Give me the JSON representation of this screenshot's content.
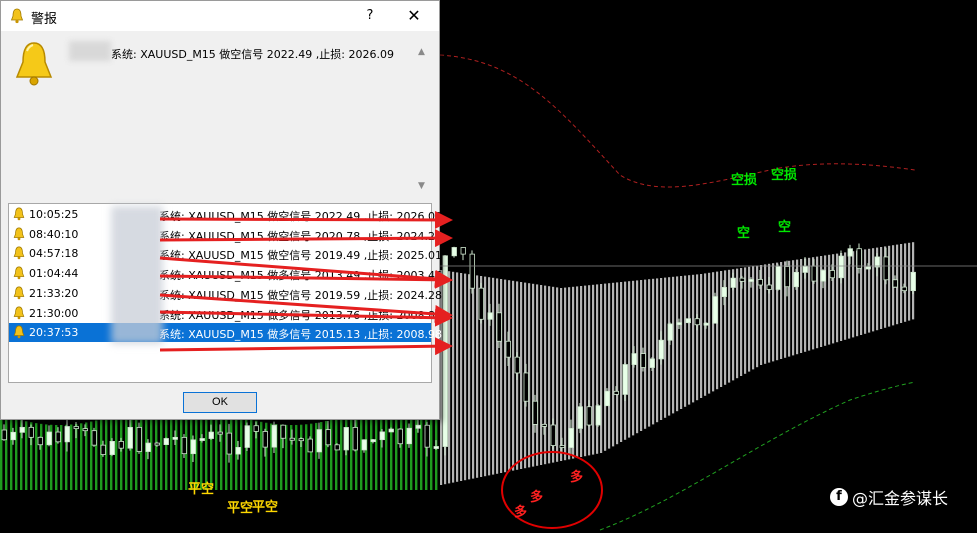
{
  "dialog": {
    "title": "警报",
    "help": "?",
    "close": "✕",
    "message": "系统:  XAUUSD_M15 做空信号 2022.49 ,止损: 2026.09",
    "ok_label": "OK",
    "alerts": [
      {
        "time": "10:05:25",
        "text": "系统:  XAUUSD_M15 做空信号 2022.49 ,止损: 2026.09"
      },
      {
        "time": "08:40:10",
        "text": "系统:  XAUUSD_M15 做空信号 2020.78 ,止损: 2024.26"
      },
      {
        "time": "04:57:18",
        "text": "系统:  XAUUSD_M15 做空信号 2019.49 ,止损: 2025.01"
      },
      {
        "time": "01:04:44",
        "text": "系统:  XAUUSD_M15 做多信号 2013.49 ,止损: 2003.46"
      },
      {
        "time": "21:33:20",
        "text": "系统:  XAUUSD_M15 做空信号 2019.59 ,止损: 2024.28"
      },
      {
        "time": "21:30:00",
        "text": "系统:  XAUUSD_M15 做多信号 2013.76 ,止损: 2008.89"
      },
      {
        "time": "20:37:53",
        "text": "系统:  XAUUSD_M15 做多信号 2015.13 ,止损: 2008.98",
        "selected": true
      }
    ]
  },
  "signals": {
    "sell": "空",
    "sell_stop": "空损",
    "buy": "多",
    "flat_short": "平空"
  },
  "watermark": {
    "icon": "facebook-icon",
    "text": "@汇金参谋长"
  },
  "colors": {
    "sell_signal": "#00e800",
    "buy_signal": "#ff2020",
    "flat_signal": "#ffd800",
    "selected_row": "#0a72d6",
    "arrow": "#e52020"
  }
}
